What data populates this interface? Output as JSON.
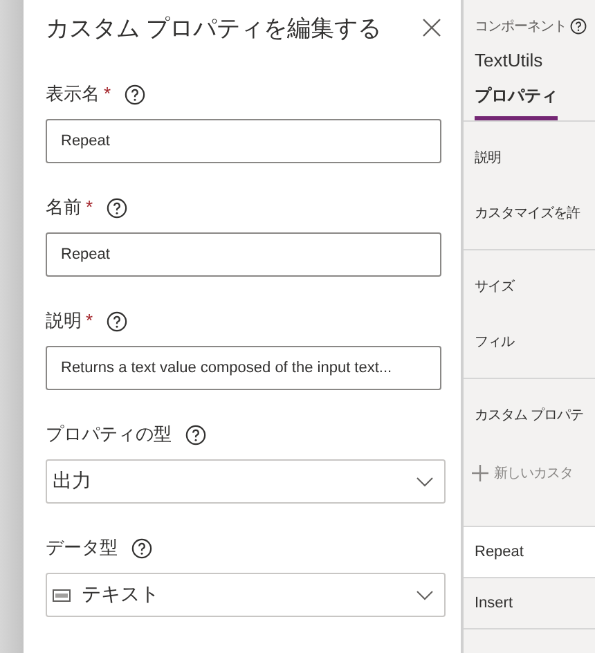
{
  "dialog": {
    "title": "カスタム プロパティを編集する",
    "fields": [
      {
        "kind": "text",
        "label": "表示名",
        "asterisk": "*",
        "value": "Repeat"
      },
      {
        "kind": "text",
        "label": "名前",
        "asterisk": "*",
        "value": "Repeat"
      },
      {
        "kind": "text",
        "label": "説明",
        "asterisk": "*",
        "value": "Returns a text value composed of the input text..."
      },
      {
        "kind": "dropdown",
        "label": "プロパティの型",
        "value": "出力"
      },
      {
        "kind": "dropdown",
        "label": "データ型",
        "value": "テキスト",
        "type_icon": true
      }
    ]
  },
  "side_panel": {
    "heading": "コンポーネント",
    "component_name": "TextUtils",
    "tabs": [
      {
        "label": "プロパティ",
        "selected": true
      }
    ],
    "sections": [
      {
        "items": [
          {
            "kind": "row",
            "label": "説明"
          },
          {
            "kind": "row",
            "label": "カスタマイズを許"
          }
        ]
      },
      {
        "items": [
          {
            "kind": "row",
            "label": "サイズ"
          },
          {
            "kind": "row",
            "label": "フィル"
          }
        ]
      },
      {
        "items": [
          {
            "kind": "row",
            "label": "カスタム プロパテ"
          },
          {
            "kind": "add",
            "label": "新しいカスタ"
          }
        ]
      }
    ],
    "properties": [
      {
        "label": "Repeat",
        "selected": true
      },
      {
        "label": "Insert",
        "selected": false
      }
    ]
  }
}
